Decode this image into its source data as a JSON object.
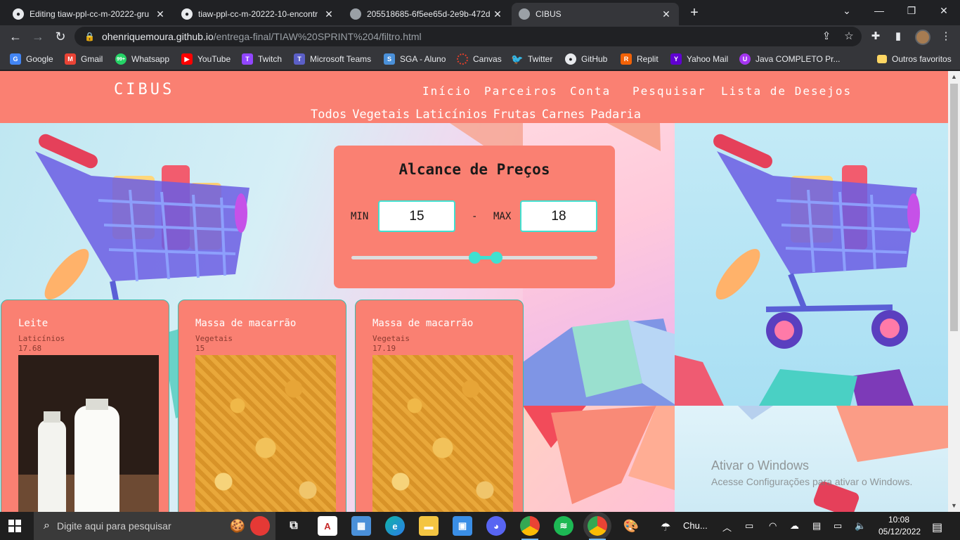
{
  "browser": {
    "tabs": [
      {
        "title": "Editing tiaw-ppl-cc-m-20222-gru",
        "favicon": "github-icon",
        "active": false
      },
      {
        "title": "tiaw-ppl-cc-m-20222-10-encontr",
        "favicon": "github-icon",
        "active": false
      },
      {
        "title": "205518685-6f5ee65d-2e9b-472d",
        "favicon": "globe-icon",
        "active": false
      },
      {
        "title": "CIBUS",
        "favicon": "globe-icon",
        "active": true
      }
    ],
    "url_host": "ohenriquemoura.github.io",
    "url_path": "/entrega-final/TIAW%20SPRINT%204/filtro.html",
    "bookmarks": [
      {
        "label": "Google",
        "color": "#4285f4",
        "glyph": "G"
      },
      {
        "label": "Gmail",
        "color": "#ea4335",
        "glyph": "M"
      },
      {
        "label": "Whatsapp",
        "color": "#25d366",
        "glyph": "99+"
      },
      {
        "label": "YouTube",
        "color": "#ff0000",
        "glyph": "▶"
      },
      {
        "label": "Twitch",
        "color": "#9146ff",
        "glyph": "T"
      },
      {
        "label": "Microsoft Teams",
        "color": "#5b5fc7",
        "glyph": "T"
      },
      {
        "label": "SGA - Aluno",
        "color": "#4a90d9",
        "glyph": "S"
      },
      {
        "label": "Canvas",
        "color": "#e13f2b",
        "glyph": "◌"
      },
      {
        "label": "Twitter",
        "color": "#1da1f2",
        "glyph": "t"
      },
      {
        "label": "GitHub",
        "color": "#e8eaed",
        "glyph": "●"
      },
      {
        "label": "Replit",
        "color": "#f26207",
        "glyph": "R"
      },
      {
        "label": "Yahoo Mail",
        "color": "#6001d2",
        "glyph": "Y"
      },
      {
        "label": "Java COMPLETO Pr...",
        "color": "#a435f0",
        "glyph": "U"
      }
    ],
    "other_bookmarks": "Outros favoritos"
  },
  "site": {
    "brand": "CIBUS",
    "nav": [
      "Início",
      "Parceiros",
      "Conta",
      "Pesquisar",
      "Lista de Desejos"
    ],
    "categories": [
      "Todos",
      "Vegetais",
      "Laticínios",
      "Frutas",
      "Carnes",
      "Padaria"
    ],
    "price_filter": {
      "title": "Alcance de Preços",
      "min_label": "MIN",
      "max_label": "MAX",
      "separator": "-",
      "min_value": "15",
      "max_value": "18",
      "slider_min_fraction": 0.5,
      "slider_max_fraction": 0.59
    },
    "products": [
      {
        "name": "Leite",
        "category": "Laticínios",
        "price": "17.68",
        "image": "milk-bottles"
      },
      {
        "name": "Massa de macarrão",
        "category": "Vegetais",
        "price": "15",
        "image": "pasta"
      },
      {
        "name": "Massa de macarrão",
        "category": "Vegetais",
        "price": "17.19",
        "image": "pasta"
      }
    ],
    "accent_color": "#fa8072",
    "highlight_color": "#40e0d0"
  },
  "watermark": {
    "title": "Ativar o Windows",
    "subtitle": "Acesse Configurações para ativar o Windows."
  },
  "taskbar": {
    "search_placeholder": "Digite aqui para pesquisar",
    "weather": "Chu...",
    "time": "10:08",
    "date": "05/12/2022"
  }
}
